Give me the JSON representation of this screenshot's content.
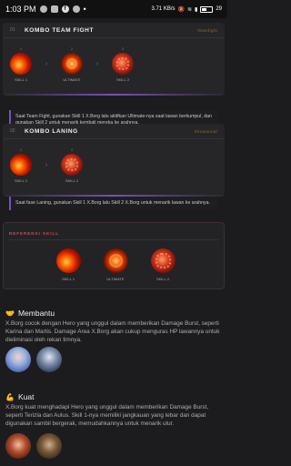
{
  "status_bar": {
    "time": "1:03 PM",
    "speed": "3.71 KB/s",
    "battery": "29"
  },
  "combo_team_fight": {
    "number": "01",
    "title": "KOMBO TEAM FIGHT",
    "tag": "Teamfight",
    "steps": [
      "1",
      "2",
      "3"
    ],
    "skills": [
      "SKILL 1",
      "ULTIMATE",
      "SKILL 2"
    ],
    "description": "Saat Team Fight, gunakan Skill 1 X.Borg lalu aktifkan Ultimate-nya saat lawan berkumpul, dan gunakan Skill 2 untuk menarik kembali mereka ke arahnya."
  },
  "combo_laning": {
    "number": "02",
    "title": "KOMBO LANING",
    "tag": "Situasional",
    "steps": [
      "1",
      "2"
    ],
    "skills": [
      "SKILL 1",
      "SKILL 2"
    ],
    "description": "Saat fase Laning, gunakan Skill 1 X.Borg lalu Skill 2 X.Borg untuk menarik lawan ke arahnya."
  },
  "reference": {
    "title": "REFERENSI SKILL",
    "skills": [
      "SKILL 1",
      "ULTIMATE",
      "SKILL 2"
    ]
  },
  "membantu": {
    "emoji": "🤝",
    "title": "Membantu",
    "text": "X.Borg cocok dengan Hero yang unggul dalam memberikan Damage Burst, seperti Karina dan Martis. Damage Area X.Borg akan cukup menguras HP lawannya untuk dieliminasi oleh rekan timnya."
  },
  "kuat": {
    "emoji": "💪",
    "title": "Kuat",
    "text": "X.Borg kuat menghadapi Hero yang unggul dalam memberikan Damage Burst, seperti Terizla dan Aulus. Skill 1-nya memiliki jangkauan yang lebar dan dapat digunakan sambil bergerak, memudahkannya untuk menarik ulur."
  }
}
